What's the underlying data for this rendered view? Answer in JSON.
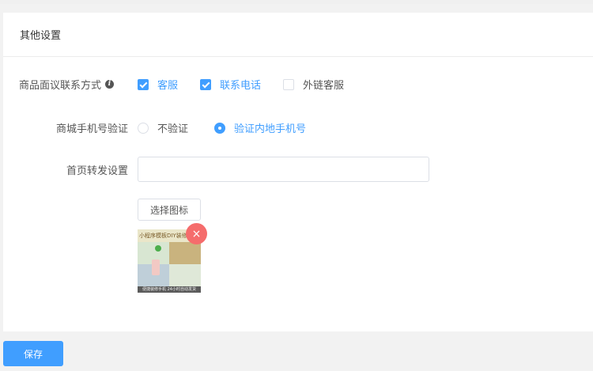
{
  "section": {
    "title": "其他设置"
  },
  "contact": {
    "label": "商品面议联系方式",
    "info_icon": "info-icon",
    "options": [
      {
        "label": "客服",
        "checked": true
      },
      {
        "label": "联系电话",
        "checked": true
      },
      {
        "label": "外链客服",
        "checked": false
      }
    ]
  },
  "phone_verify": {
    "label": "商城手机号验证",
    "options": [
      {
        "label": "不验证",
        "selected": false
      },
      {
        "label": "验证内地手机号",
        "selected": true
      }
    ]
  },
  "homepage_share": {
    "label": "首页转发设置",
    "input_value": "",
    "select_icon_label": "选择图标",
    "thumbnail": {
      "banner_text": "小程序模板DIY装修 立",
      "footer_text": "便捷装修手机 24小时自动发货"
    },
    "remove_icon": "close-icon"
  },
  "actions": {
    "save_label": "保存"
  },
  "colors": {
    "accent": "#409eff",
    "danger": "#f56c6c"
  }
}
